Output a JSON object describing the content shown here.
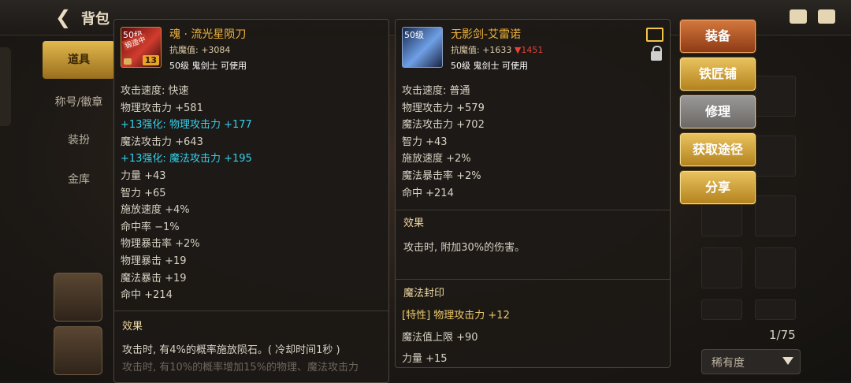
{
  "topbar": {
    "title": "背包"
  },
  "sidebar": {
    "tabs": [
      {
        "label": "道具",
        "active": true
      },
      {
        "label": "称号/徽章",
        "active": false
      },
      {
        "label": "装扮",
        "active": false
      },
      {
        "label": "金库",
        "active": false
      }
    ]
  },
  "actions": {
    "equip": "装备",
    "blacksmith": "铁匠铺",
    "repair": "修理",
    "source": "获取途径",
    "share": "分享"
  },
  "inventory": {
    "page_count": "1/75",
    "sort_label": "稀有度"
  },
  "item1": {
    "name": "魂 · 流光星陨刀",
    "resist_label": "抗魔值: ",
    "resist_value": "+3084",
    "level_req": "50级 鬼剑士 可使用",
    "level_badge": "50级",
    "enhance_badge": "13",
    "ribbon": "锻造中",
    "stats": [
      {
        "text": "攻击速度: 快速",
        "color": "normal"
      },
      {
        "text": "物理攻击力 +581",
        "color": "normal"
      },
      {
        "text": "+13强化: 物理攻击力 +177",
        "color": "cyan"
      },
      {
        "text": "魔法攻击力 +643",
        "color": "normal"
      },
      {
        "text": "+13强化: 魔法攻击力 +195",
        "color": "cyan"
      },
      {
        "text": "力量 +43",
        "color": "normal"
      },
      {
        "text": "智力 +65",
        "color": "normal"
      },
      {
        "text": "施放速度 +4%",
        "color": "normal"
      },
      {
        "text": "命中率 −1%",
        "color": "normal"
      },
      {
        "text": "物理暴击率 +2%",
        "color": "normal"
      },
      {
        "text": "物理暴击 +19",
        "color": "normal"
      },
      {
        "text": "魔法暴击 +19",
        "color": "normal"
      },
      {
        "text": "命中 +214",
        "color": "normal"
      }
    ],
    "effect_title": "效果",
    "effect_text": "攻击时, 有4%的概率施放陨石。( 冷却时间1秒 )",
    "effect_text_2": "攻击时, 有10%的概率增加15%的物理、魔法攻击力"
  },
  "item2": {
    "name": "无影剑-艾雷诺",
    "resist_label": "抗魔值: ",
    "resist_value": "+1633",
    "resist_diff": "▼1451",
    "level_req": "50级 鬼剑士 可使用",
    "level_badge": "50级",
    "stats": [
      {
        "text": "攻击速度: 普通"
      },
      {
        "text": "物理攻击力 +579"
      },
      {
        "text": "魔法攻击力 +702"
      },
      {
        "text": "智力 +43"
      },
      {
        "text": "施放速度 +2%"
      },
      {
        "text": "魔法暴击率 +2%"
      },
      {
        "text": "命中 +214"
      }
    ],
    "effect_title": "效果",
    "effect_text": "攻击时, 附加30%的伤害。",
    "seal_title": "魔法封印",
    "seal_lines": [
      {
        "text": "[特性] 物理攻击力 +12",
        "color": "gold"
      },
      {
        "text": "魔法值上限 +90",
        "color": "normal"
      },
      {
        "text": "力量 +15",
        "color": "normal"
      }
    ]
  },
  "colors": {
    "gold": "#f0b23a",
    "cyan": "#35d0ea",
    "red": "#e2423a"
  }
}
